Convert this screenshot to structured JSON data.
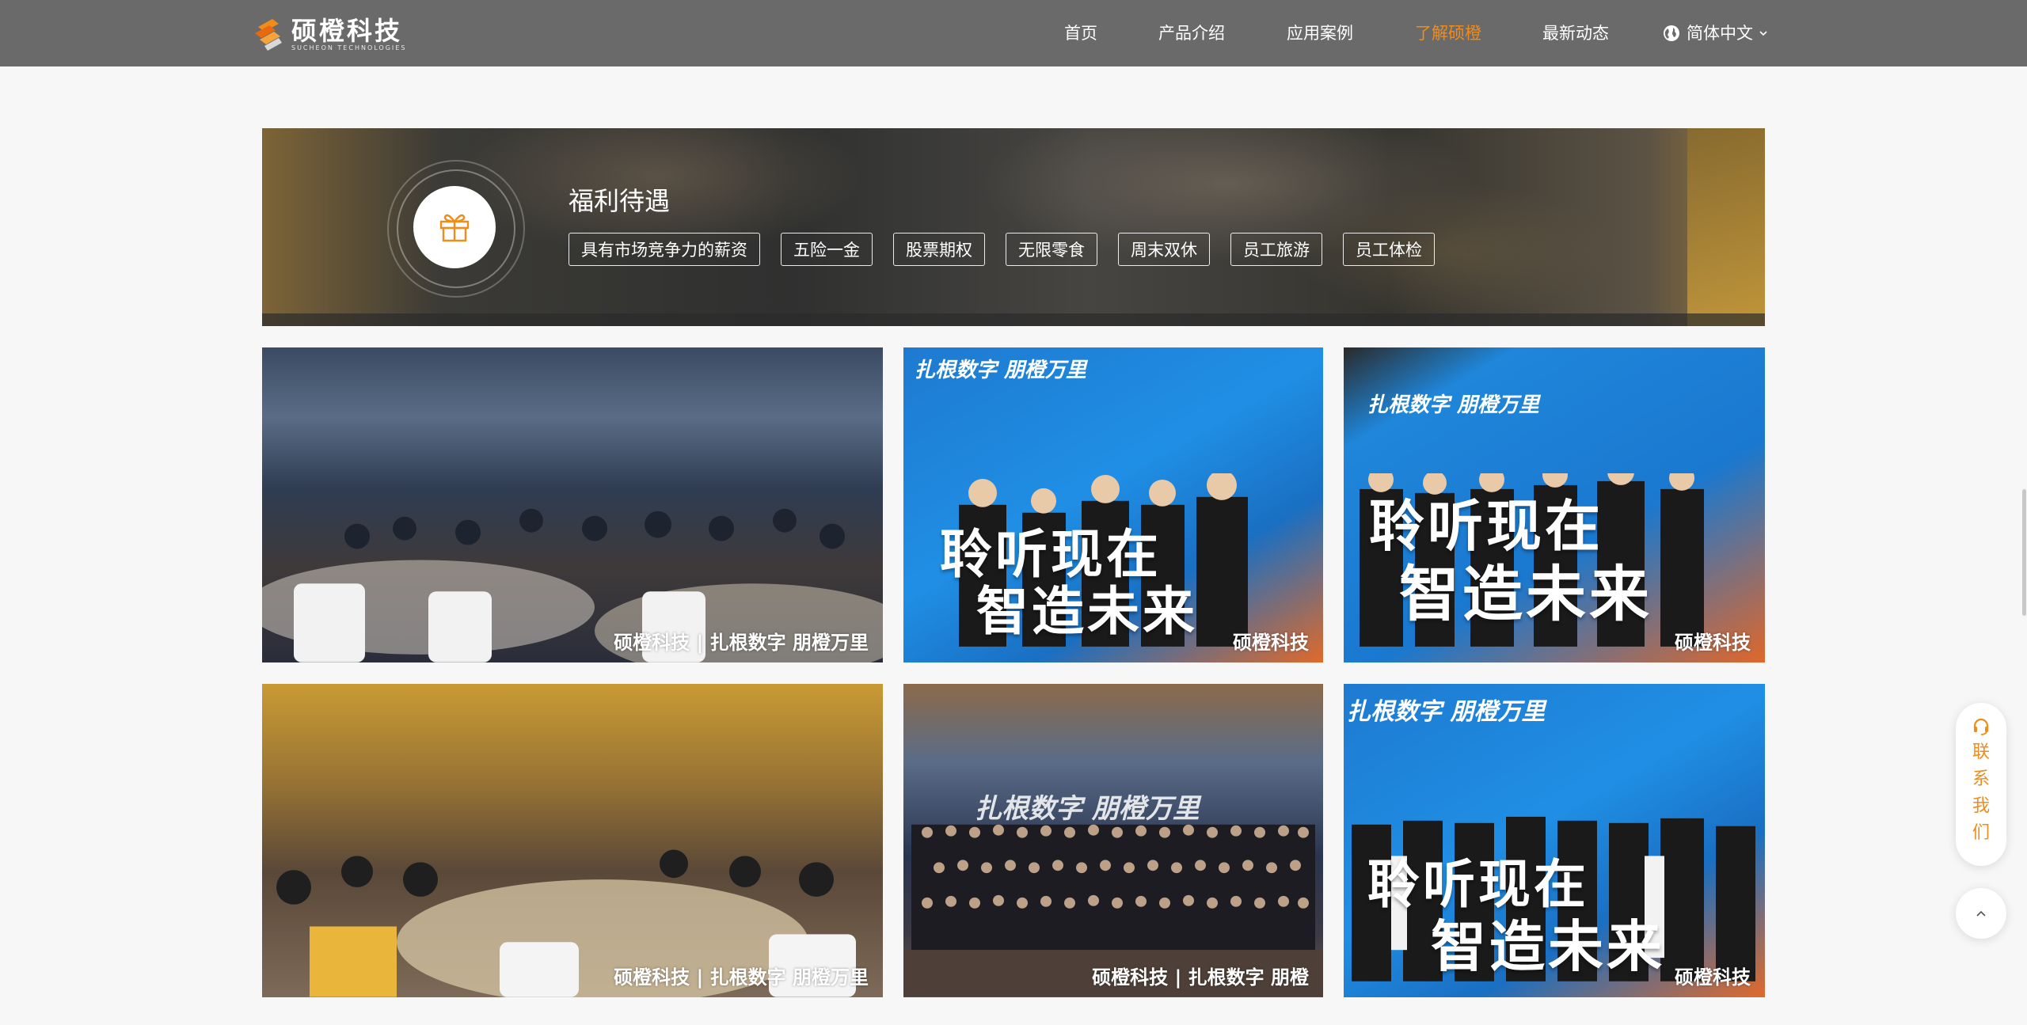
{
  "header": {
    "logo_cn": "硕橙科技",
    "logo_en": "SUCHEON TECHNOLOGIES",
    "nav": [
      {
        "label": "首页",
        "active": false
      },
      {
        "label": "产品介绍",
        "active": false
      },
      {
        "label": "应用案例",
        "active": false
      },
      {
        "label": "了解硕橙",
        "active": true
      },
      {
        "label": "最新动态",
        "active": false
      }
    ],
    "language": "简体中文"
  },
  "benefits": {
    "title": "福利待遇",
    "tags": [
      "具有市场竞争力的薪资",
      "五险一金",
      "股票期权",
      "无限零食",
      "周末双休",
      "员工旅游",
      "员工体检"
    ]
  },
  "photos": [
    {
      "watermark": "硕橙科技 | 扎根数字 朋橙万里"
    },
    {
      "slogan_top": "扎根数字 朋橙万里",
      "slogan_1": "聆听现在",
      "slogan_2": "智造未来",
      "watermark": "硕橙科技"
    },
    {
      "slogan_top": "扎根数字 朋橙万里",
      "slogan_1": "聆听现在",
      "slogan_2": "智造未来",
      "watermark": "硕橙科技"
    },
    {
      "watermark": "硕橙科技 | 扎根数字 朋橙万里"
    },
    {
      "slogan_top": "扎根数字 朋橙万里",
      "watermark": "硕橙科技 | 扎根数字 朋橙"
    },
    {
      "slogan_top": "扎根数字 朋橙万里",
      "slogan_1": "聆听现在",
      "slogan_2": "智造未来",
      "watermark": "硕橙科技"
    }
  ],
  "side": {
    "contact_label": "联系我们"
  },
  "colors": {
    "accent": "#f08c1a",
    "header_bg": "#6a6a6a"
  },
  "icons": [
    "logo-icon",
    "globe-icon",
    "chevron-down-icon",
    "gift-icon",
    "headset-icon",
    "arrow-up-icon"
  ]
}
